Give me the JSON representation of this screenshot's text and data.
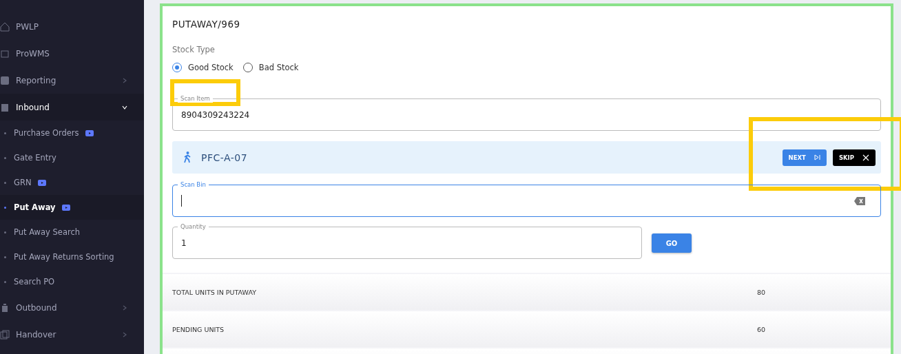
{
  "sidebar": {
    "items": [
      {
        "label": "PWLP",
        "expanded": false,
        "has_children": false
      },
      {
        "label": "ProWMS",
        "expanded": false,
        "has_children": false
      },
      {
        "label": "Reporting",
        "expanded": false,
        "has_children": true
      },
      {
        "label": "Inbound",
        "expanded": true,
        "has_children": true,
        "children": [
          {
            "label": "Purchase Orders",
            "has_video": true,
            "selected": false
          },
          {
            "label": "Gate Entry",
            "has_video": false,
            "selected": false
          },
          {
            "label": "GRN",
            "has_video": true,
            "selected": false
          },
          {
            "label": "Put Away",
            "has_video": true,
            "selected": true
          },
          {
            "label": "Put Away Search",
            "has_video": false,
            "selected": false
          },
          {
            "label": "Put Away Returns Sorting",
            "has_video": false,
            "selected": false
          },
          {
            "label": "Search PO",
            "has_video": false,
            "selected": false
          }
        ]
      },
      {
        "label": "Outbound",
        "expanded": false,
        "has_children": true
      },
      {
        "label": "Handover",
        "expanded": false,
        "has_children": true
      }
    ]
  },
  "card": {
    "title": "PUTAWAY/969",
    "stock_type": {
      "label": "Stock Type",
      "options": [
        {
          "label": "Good Stock",
          "selected": true
        },
        {
          "label": "Bad Stock",
          "selected": false
        }
      ]
    },
    "scan_item": {
      "label": "Scan Item",
      "value": "8904309243224",
      "highlighted": true
    },
    "location": {
      "code": "PFC-A-07",
      "actions": [
        {
          "kind": "next",
          "label": "NEXT"
        },
        {
          "kind": "skip",
          "label": "SKIP"
        }
      ],
      "highlighted": true
    },
    "scan_bin": {
      "label": "Scan Bin",
      "focused": true
    },
    "quantity": {
      "label": "Quantity",
      "value": "1"
    },
    "go_button": "GO"
  },
  "stats": [
    {
      "label": "TOTAL UNITS IN PUTAWAY",
      "value": "80"
    },
    {
      "label": "PENDING UNITS",
      "value": "60"
    }
  ]
}
